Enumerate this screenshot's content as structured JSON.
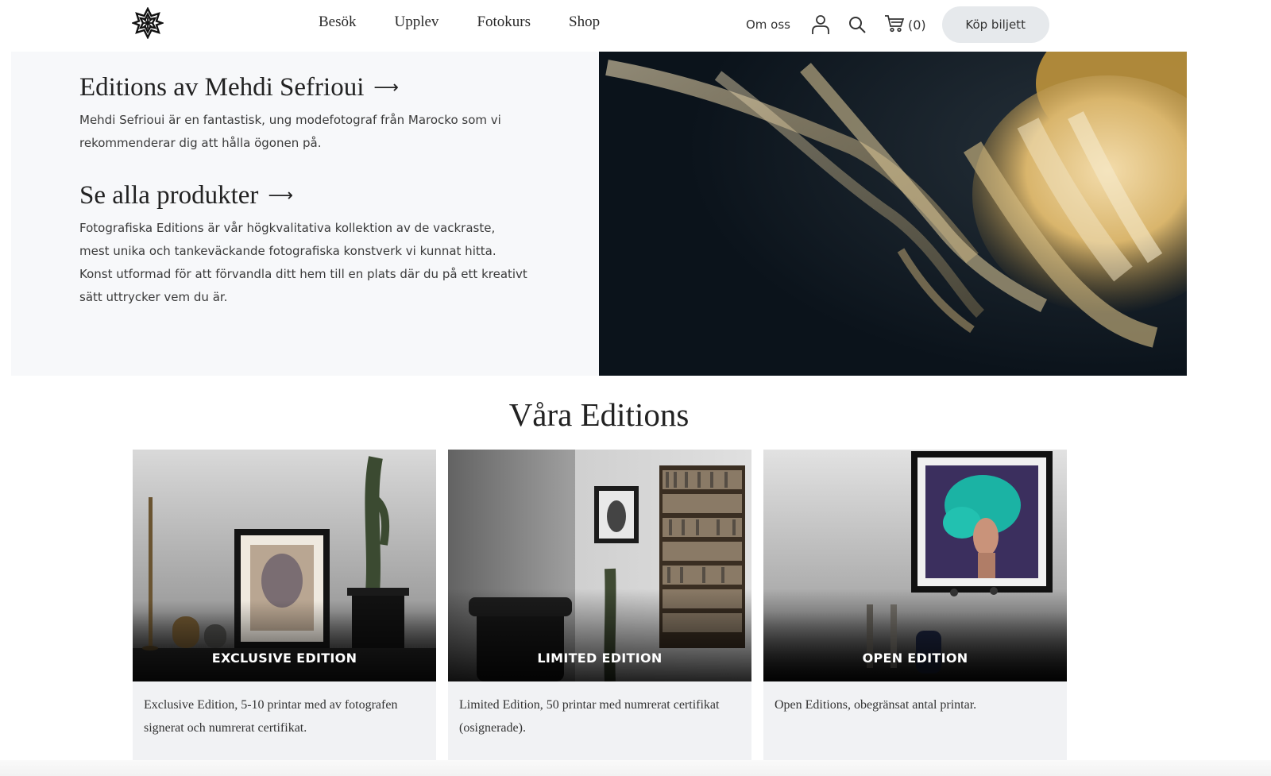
{
  "header": {
    "logo_icon": "star-ornament-icon",
    "nav": [
      "Besök",
      "Upplev",
      "Fotokurs",
      "Shop"
    ],
    "about": "Om oss",
    "account_icon": "user-icon",
    "search_icon": "search-icon",
    "cart_icon": "cart-icon",
    "cart_count": "(0)",
    "ticket_button": "Köp biljett"
  },
  "hero": {
    "blocks": [
      {
        "title": "Editions av Mehdi Sefrioui",
        "arrow": "⟶",
        "lines": [
          "Mehdi Sefrioui är en fantastisk, ung modefotograf från Marocko som vi",
          "rekommenderar dig att hålla ögonen på."
        ]
      },
      {
        "title": "Se alla produkter",
        "arrow": "⟶",
        "lines": [
          "Fotografiska Editions är vår högkvalitativa kollektion av de vackraste,",
          "mest unika och tankeväckande fotografiska konstverk vi kunnat hitta.",
          "Konst utformad för att förvandla ditt hem till en plats där du på ett kreativt",
          "sätt uttrycker vem du är."
        ]
      }
    ],
    "image_subject": "jellyfish-photo"
  },
  "section": {
    "title": "Våra Editions",
    "cards": [
      {
        "label": "EXCLUSIVE EDITION",
        "lines": [
          "Exclusive Edition, 5-10 printar med av fotografen",
          "signerat och numrerat certifikat."
        ]
      },
      {
        "label": "LIMITED EDITION",
        "lines": [
          "Limited Edition, 50 printar med numrerat certifikat",
          "(osignerade)."
        ]
      },
      {
        "label": "OPEN EDITION",
        "lines": [
          "Open Editions, obegränsat antal printar."
        ]
      }
    ]
  },
  "colors": {
    "hero_bg": "#f7f8fa",
    "card_bg": "#f1f2f4",
    "button_bg": "#e6e9ec",
    "photo_dark": "#0c141d"
  }
}
